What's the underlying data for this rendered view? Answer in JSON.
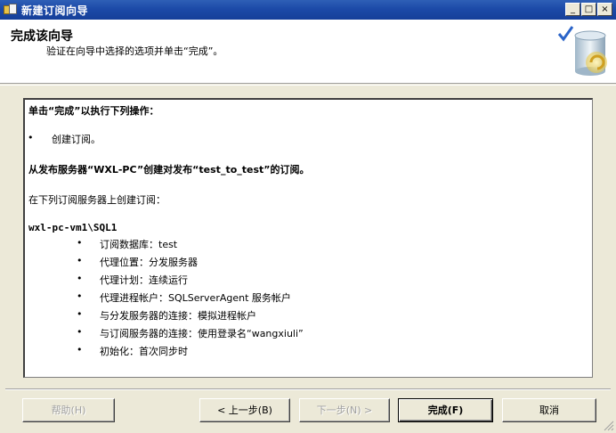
{
  "window": {
    "title": "新建订阅向导",
    "minimize": "_",
    "maximize": "□",
    "close": "×"
  },
  "header": {
    "title": "完成该向导",
    "subtitle": "验证在向导中选择的选项并单击“完成”。"
  },
  "content": {
    "intro": "单击“完成”以执行下列操作：",
    "action_bullet": "创建订阅。",
    "publisher_line": "从发布服务器“WXL-PC”创建对发布“test_to_test”的订阅。",
    "subscriber_intro": "在下列订阅服务器上创建订阅：",
    "subscriber_name": "wxl-pc-vm1\\SQL1",
    "details": [
      "订阅数据库：test",
      "代理位置：分发服务器",
      "代理计划：连续运行",
      "代理进程帐户：SQLServerAgent 服务帐户",
      "与分发服务器的连接：模拟进程帐户",
      "与订阅服务器的连接：使用登录名“wangxiuli”",
      "初始化：首次同步时"
    ],
    "bullet_char": "•"
  },
  "buttons": {
    "help": "帮助(H)",
    "back": "< 上一步(B)",
    "next": "下一步(N) >",
    "finish": "完成(F)",
    "cancel": "取消"
  }
}
